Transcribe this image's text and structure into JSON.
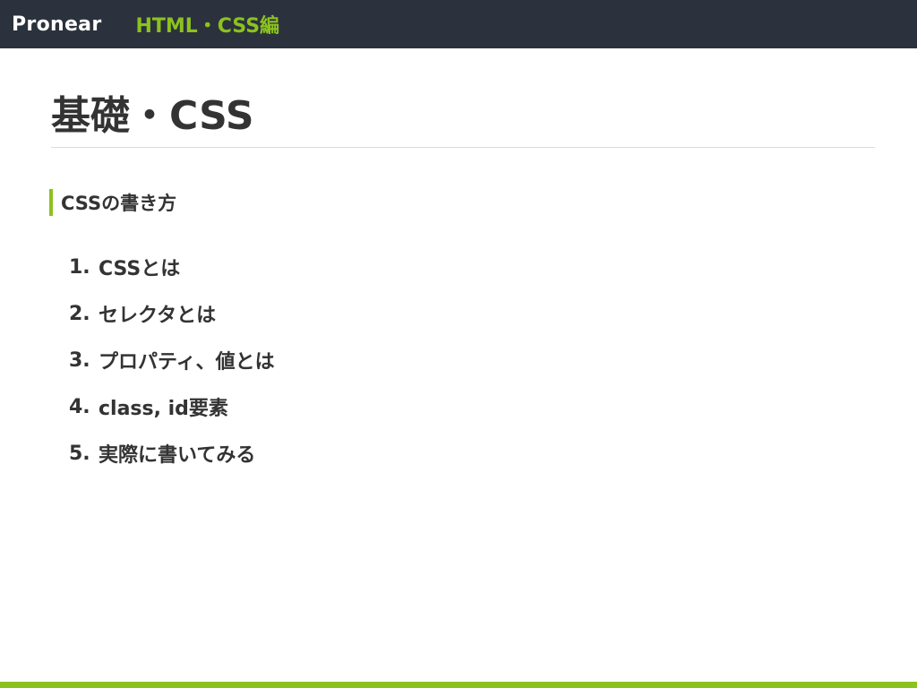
{
  "header": {
    "brand": "Pronear",
    "section": "HTML・CSS編"
  },
  "slide": {
    "title": "基礎・CSS",
    "subheading": "CSSの書き方",
    "items": [
      {
        "num": "1.",
        "text": "CSSとは"
      },
      {
        "num": "2.",
        "text": "セレクタとは"
      },
      {
        "num": "3.",
        "text": "プロパティ、値とは"
      },
      {
        "num": "4.",
        "text": "class, id要素"
      },
      {
        "num": "5.",
        "text": "実際に書いてみる"
      }
    ]
  },
  "colors": {
    "header_bg": "#2b323d",
    "accent": "#8cc21e",
    "text": "#333333"
  }
}
